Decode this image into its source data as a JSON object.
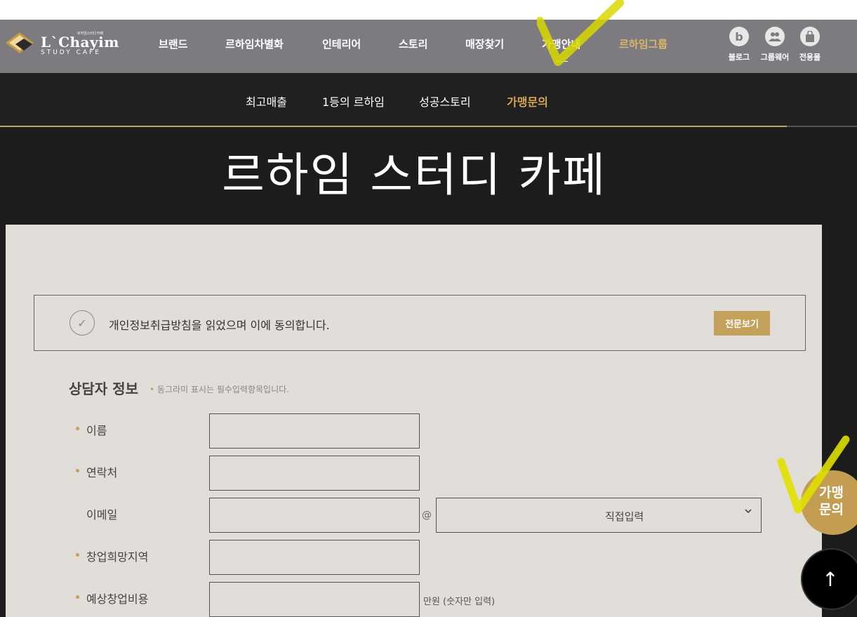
{
  "brand": {
    "logo_small": "르하임스터디카페",
    "logo_text": "L`Chayim",
    "logo_sub": "STUDY CAFE"
  },
  "topnav": {
    "items": [
      {
        "label": "브랜드"
      },
      {
        "label": "르하임차별화"
      },
      {
        "label": "인테리어"
      },
      {
        "label": "스토리"
      },
      {
        "label": "매장찾기"
      },
      {
        "label": "가맹안내"
      },
      {
        "label": "르하임그룹"
      }
    ],
    "utils": [
      {
        "glyph": "b",
        "label": "블로그",
        "icon": "blog-icon"
      },
      {
        "glyph": "👥",
        "label": "그룹웨어",
        "icon": "groupware-icon"
      },
      {
        "glyph": "🛍",
        "label": "전용몰",
        "icon": "shopping-bag-icon"
      }
    ]
  },
  "subnav": {
    "items": [
      {
        "label": "최고매출"
      },
      {
        "label": "1등의 르하임"
      },
      {
        "label": "성공스토리"
      },
      {
        "label": "가맹문의"
      }
    ]
  },
  "hero": {
    "title": "르하임 스터디 카페"
  },
  "form": {
    "agree_text": "개인정보취급방침을 읽었으며 이에 동의합니다.",
    "view_button": "전문보기",
    "section_title": "상담자 정보",
    "section_note": "동그라미 표시는 필수입력항목입니다.",
    "fields": {
      "name": {
        "label": "이름",
        "value": ""
      },
      "phone": {
        "label": "연락처",
        "value": ""
      },
      "email": {
        "label": "이메일",
        "at": "@",
        "domain_select": "직접입력"
      },
      "region": {
        "label": "창업희망지역",
        "value": ""
      },
      "budget": {
        "label": "예상창업비용",
        "unit": "만원 (숫자만 입력)"
      }
    }
  },
  "floating": {
    "inquiry_line1": "가맹",
    "inquiry_line2": "문의",
    "top_arrow": "↑"
  },
  "colors": {
    "topnav_bg": "#7d7b80",
    "subnav_bg": "#202020",
    "accent_gold": "#c4a15a",
    "panel_bg": "#e1ddd8"
  }
}
